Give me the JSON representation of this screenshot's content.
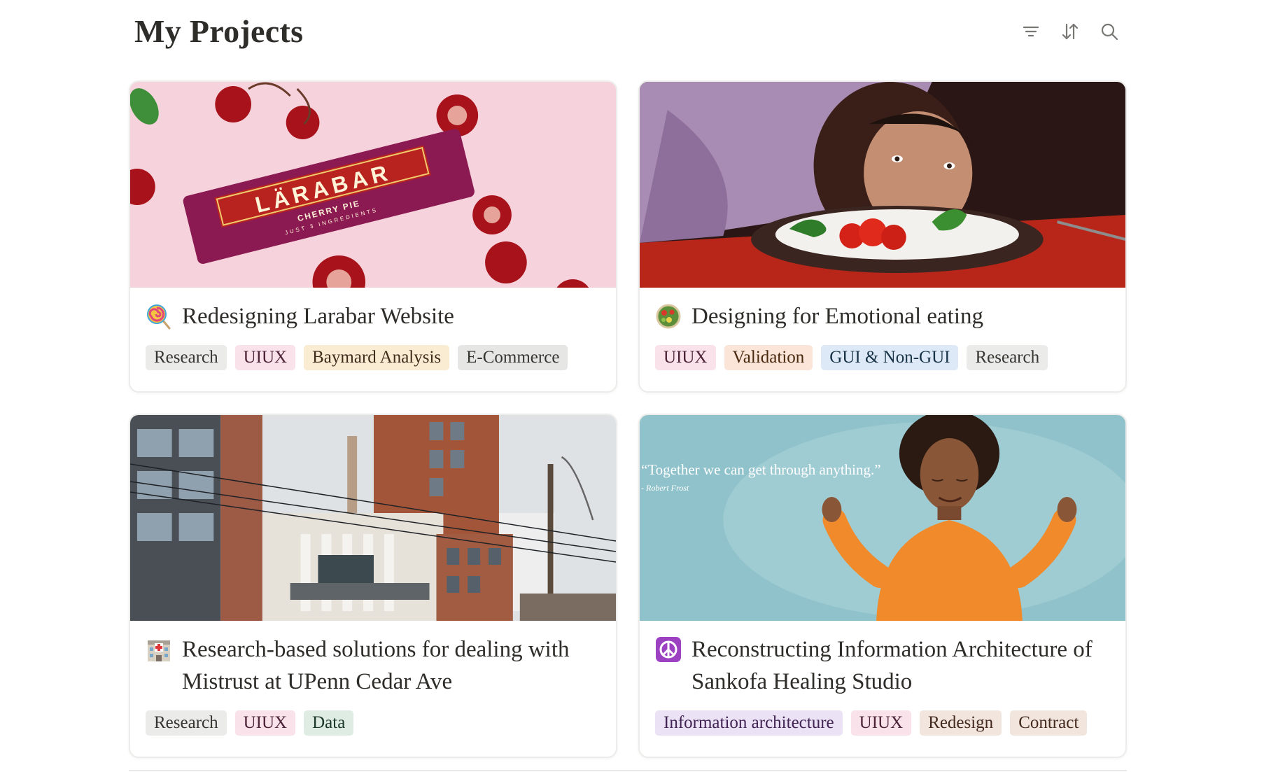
{
  "header": {
    "title": "My Projects",
    "filter_icon": "filter-icon",
    "sort_icon": "sort-icon",
    "search_icon": "search-icon"
  },
  "cards": [
    {
      "title": "Redesigning Larabar Website",
      "emoji": "lollipop",
      "cover": "Larabar cherry pie bar with cherries on pink background",
      "cover_text": {
        "brand": "LÄRABAR",
        "flavor": "CHERRY PIE",
        "sub": "JUST 3 INGREDIENTS"
      },
      "tags": [
        {
          "label": "Research",
          "bg": "#ebebea",
          "fg": "#37352f"
        },
        {
          "label": "UIUX",
          "bg": "#f9e2ea",
          "fg": "#4c2337"
        },
        {
          "label": "Baymard Analysis",
          "bg": "#faebd3",
          "fg": "#402c1b"
        },
        {
          "label": "E-Commerce",
          "bg": "#e6e6e4",
          "fg": "#37352f"
        }
      ]
    },
    {
      "title": "Designing for Emotional eating",
      "emoji": "salad",
      "cover": "Woman resting head on table looking at small salad plate",
      "tags": [
        {
          "label": "UIUX",
          "bg": "#f9e2ea",
          "fg": "#4c2337"
        },
        {
          "label": "Validation",
          "bg": "#fbe4d8",
          "fg": "#49290e"
        },
        {
          "label": "GUI & Non-GUI",
          "bg": "#dde9f6",
          "fg": "#183347"
        },
        {
          "label": "Research",
          "bg": "#ebebea",
          "fg": "#37352f"
        }
      ]
    },
    {
      "title": "Research-based solutions for dealing with Mistrust at UPenn Cedar Ave",
      "emoji": "hospital",
      "cover": "Brick hospital building on Cedar Ave street",
      "tags": [
        {
          "label": "Research",
          "bg": "#ebebea",
          "fg": "#37352f"
        },
        {
          "label": "UIUX",
          "bg": "#f9e2ea",
          "fg": "#4c2337"
        },
        {
          "label": "Data",
          "bg": "#dfece3",
          "fg": "#1c3829"
        }
      ]
    },
    {
      "title": "Reconstructing Information Architecture of Sankofa Healing Studio",
      "emoji": "peace-symbol",
      "cover": "Smiling woman in orange sweater meditating on teal background",
      "cover_quote": "“Together we can get through anything.”",
      "cover_author": "- Robert Frost",
      "tags": [
        {
          "label": "Information architecture",
          "bg": "#ebe2f5",
          "fg": "#412454"
        },
        {
          "label": "UIUX",
          "bg": "#f9e2ea",
          "fg": "#4c2337"
        },
        {
          "label": "Redesign",
          "bg": "#f1e5dd",
          "fg": "#442a1e"
        },
        {
          "label": "Contract",
          "bg": "#f1e5dd",
          "fg": "#442a1e"
        }
      ]
    }
  ]
}
